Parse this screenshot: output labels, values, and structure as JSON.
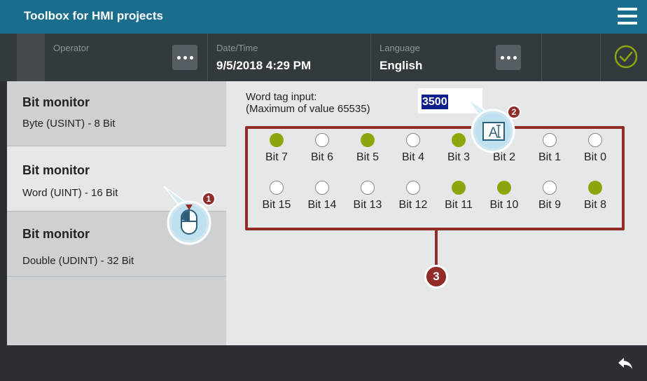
{
  "app": {
    "title": "Toolbox for HMI projects"
  },
  "infobar": {
    "operator_label": "Operator",
    "datetime_label": "Date/Time",
    "datetime_value": "9/5/2018 4:29 PM",
    "language_label": "Language",
    "language_value": "English"
  },
  "sidebar": {
    "items": [
      {
        "title": "Bit monitor",
        "subtitle": "Byte (USINT) - 8 Bit"
      },
      {
        "title": "Bit monitor",
        "subtitle": "Word (UINT) - 16 Bit"
      },
      {
        "title": "Bit monitor",
        "subtitle": "Double (UDINT) - 32 Bit"
      }
    ],
    "active_index": 1
  },
  "main": {
    "word_label_line1": "Word tag input:",
    "word_label_line2": "(Maximum of value 65535)",
    "word_value": "3500",
    "bits_row1": [
      {
        "label": "Bit 7",
        "on": true
      },
      {
        "label": "Bit 6",
        "on": false
      },
      {
        "label": "Bit 5",
        "on": true
      },
      {
        "label": "Bit 4",
        "on": false
      },
      {
        "label": "Bit 3",
        "on": true
      },
      {
        "label": "Bit 2",
        "on": false
      },
      {
        "label": "Bit 1",
        "on": false
      },
      {
        "label": "Bit 0",
        "on": false
      }
    ],
    "bits_row2": [
      {
        "label": "Bit 15",
        "on": false
      },
      {
        "label": "Bit 14",
        "on": false
      },
      {
        "label": "Bit 13",
        "on": false
      },
      {
        "label": "Bit 12",
        "on": false
      },
      {
        "label": "Bit 11",
        "on": true
      },
      {
        "label": "Bit 10",
        "on": true
      },
      {
        "label": "Bit 9",
        "on": false
      },
      {
        "label": "Bit 8",
        "on": true
      }
    ]
  },
  "callouts": {
    "one": "1",
    "two": "2",
    "three": "3",
    "keyboard_glyph": "A"
  },
  "colors": {
    "titlebar": "#1b6d8e",
    "led_on": "#8aa80e",
    "callout": "#922c28",
    "ok_green": "#8aa80e"
  },
  "icons": [
    "menu-icon",
    "more-dots-icon",
    "ok-check-icon",
    "back-arrow-icon",
    "mouse-click-icon",
    "keyboard-input-icon"
  ]
}
